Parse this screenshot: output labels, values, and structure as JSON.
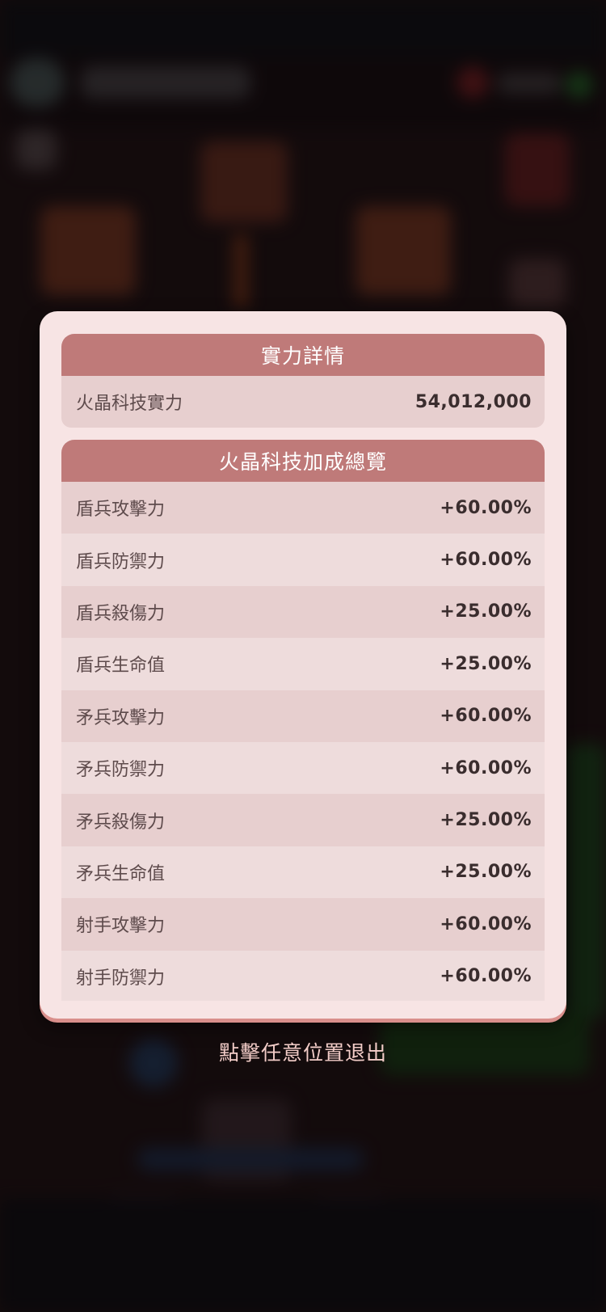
{
  "modal": {
    "power_section": {
      "title": "實力詳情",
      "row": {
        "label": "火晶科技實力",
        "value": "54,012,000"
      }
    },
    "bonus_section": {
      "title": "火晶科技加成總覽",
      "rows": [
        {
          "label": "盾兵攻擊力",
          "value": "+60.00%"
        },
        {
          "label": "盾兵防禦力",
          "value": "+60.00%"
        },
        {
          "label": "盾兵殺傷力",
          "value": "+25.00%"
        },
        {
          "label": "盾兵生命值",
          "value": "+25.00%"
        },
        {
          "label": "矛兵攻擊力",
          "value": "+60.00%"
        },
        {
          "label": "矛兵防禦力",
          "value": "+60.00%"
        },
        {
          "label": "矛兵殺傷力",
          "value": "+25.00%"
        },
        {
          "label": "矛兵生命值",
          "value": "+25.00%"
        },
        {
          "label": "射手攻擊力",
          "value": "+60.00%"
        },
        {
          "label": "射手防禦力",
          "value": "+60.00%"
        }
      ]
    }
  },
  "exit_hint": "點擊任意位置退出",
  "colors": {
    "header": "#bf7a79",
    "modal_bg": "#f7e4e4",
    "row_odd": "#e7cfcf",
    "row_even": "#eedcdc"
  }
}
